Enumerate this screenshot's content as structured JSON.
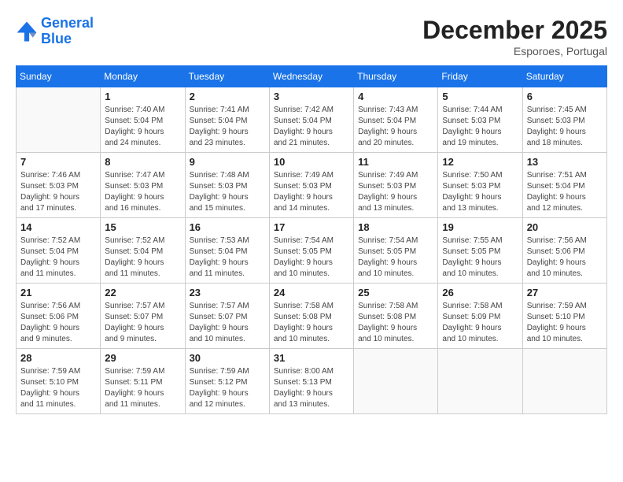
{
  "header": {
    "logo_line1": "General",
    "logo_line2": "Blue",
    "month": "December 2025",
    "location": "Esporoes, Portugal"
  },
  "days_of_week": [
    "Sunday",
    "Monday",
    "Tuesday",
    "Wednesday",
    "Thursday",
    "Friday",
    "Saturday"
  ],
  "weeks": [
    [
      {
        "day": "",
        "info": ""
      },
      {
        "day": "1",
        "info": "Sunrise: 7:40 AM\nSunset: 5:04 PM\nDaylight: 9 hours\nand 24 minutes."
      },
      {
        "day": "2",
        "info": "Sunrise: 7:41 AM\nSunset: 5:04 PM\nDaylight: 9 hours\nand 23 minutes."
      },
      {
        "day": "3",
        "info": "Sunrise: 7:42 AM\nSunset: 5:04 PM\nDaylight: 9 hours\nand 21 minutes."
      },
      {
        "day": "4",
        "info": "Sunrise: 7:43 AM\nSunset: 5:04 PM\nDaylight: 9 hours\nand 20 minutes."
      },
      {
        "day": "5",
        "info": "Sunrise: 7:44 AM\nSunset: 5:03 PM\nDaylight: 9 hours\nand 19 minutes."
      },
      {
        "day": "6",
        "info": "Sunrise: 7:45 AM\nSunset: 5:03 PM\nDaylight: 9 hours\nand 18 minutes."
      }
    ],
    [
      {
        "day": "7",
        "info": "Sunrise: 7:46 AM\nSunset: 5:03 PM\nDaylight: 9 hours\nand 17 minutes."
      },
      {
        "day": "8",
        "info": "Sunrise: 7:47 AM\nSunset: 5:03 PM\nDaylight: 9 hours\nand 16 minutes."
      },
      {
        "day": "9",
        "info": "Sunrise: 7:48 AM\nSunset: 5:03 PM\nDaylight: 9 hours\nand 15 minutes."
      },
      {
        "day": "10",
        "info": "Sunrise: 7:49 AM\nSunset: 5:03 PM\nDaylight: 9 hours\nand 14 minutes."
      },
      {
        "day": "11",
        "info": "Sunrise: 7:49 AM\nSunset: 5:03 PM\nDaylight: 9 hours\nand 13 minutes."
      },
      {
        "day": "12",
        "info": "Sunrise: 7:50 AM\nSunset: 5:03 PM\nDaylight: 9 hours\nand 13 minutes."
      },
      {
        "day": "13",
        "info": "Sunrise: 7:51 AM\nSunset: 5:04 PM\nDaylight: 9 hours\nand 12 minutes."
      }
    ],
    [
      {
        "day": "14",
        "info": "Sunrise: 7:52 AM\nSunset: 5:04 PM\nDaylight: 9 hours\nand 11 minutes."
      },
      {
        "day": "15",
        "info": "Sunrise: 7:52 AM\nSunset: 5:04 PM\nDaylight: 9 hours\nand 11 minutes."
      },
      {
        "day": "16",
        "info": "Sunrise: 7:53 AM\nSunset: 5:04 PM\nDaylight: 9 hours\nand 11 minutes."
      },
      {
        "day": "17",
        "info": "Sunrise: 7:54 AM\nSunset: 5:05 PM\nDaylight: 9 hours\nand 10 minutes."
      },
      {
        "day": "18",
        "info": "Sunrise: 7:54 AM\nSunset: 5:05 PM\nDaylight: 9 hours\nand 10 minutes."
      },
      {
        "day": "19",
        "info": "Sunrise: 7:55 AM\nSunset: 5:05 PM\nDaylight: 9 hours\nand 10 minutes."
      },
      {
        "day": "20",
        "info": "Sunrise: 7:56 AM\nSunset: 5:06 PM\nDaylight: 9 hours\nand 10 minutes."
      }
    ],
    [
      {
        "day": "21",
        "info": "Sunrise: 7:56 AM\nSunset: 5:06 PM\nDaylight: 9 hours\nand 9 minutes."
      },
      {
        "day": "22",
        "info": "Sunrise: 7:57 AM\nSunset: 5:07 PM\nDaylight: 9 hours\nand 9 minutes."
      },
      {
        "day": "23",
        "info": "Sunrise: 7:57 AM\nSunset: 5:07 PM\nDaylight: 9 hours\nand 10 minutes."
      },
      {
        "day": "24",
        "info": "Sunrise: 7:58 AM\nSunset: 5:08 PM\nDaylight: 9 hours\nand 10 minutes."
      },
      {
        "day": "25",
        "info": "Sunrise: 7:58 AM\nSunset: 5:08 PM\nDaylight: 9 hours\nand 10 minutes."
      },
      {
        "day": "26",
        "info": "Sunrise: 7:58 AM\nSunset: 5:09 PM\nDaylight: 9 hours\nand 10 minutes."
      },
      {
        "day": "27",
        "info": "Sunrise: 7:59 AM\nSunset: 5:10 PM\nDaylight: 9 hours\nand 10 minutes."
      }
    ],
    [
      {
        "day": "28",
        "info": "Sunrise: 7:59 AM\nSunset: 5:10 PM\nDaylight: 9 hours\nand 11 minutes."
      },
      {
        "day": "29",
        "info": "Sunrise: 7:59 AM\nSunset: 5:11 PM\nDaylight: 9 hours\nand 11 minutes."
      },
      {
        "day": "30",
        "info": "Sunrise: 7:59 AM\nSunset: 5:12 PM\nDaylight: 9 hours\nand 12 minutes."
      },
      {
        "day": "31",
        "info": "Sunrise: 8:00 AM\nSunset: 5:13 PM\nDaylight: 9 hours\nand 13 minutes."
      },
      {
        "day": "",
        "info": ""
      },
      {
        "day": "",
        "info": ""
      },
      {
        "day": "",
        "info": ""
      }
    ]
  ]
}
